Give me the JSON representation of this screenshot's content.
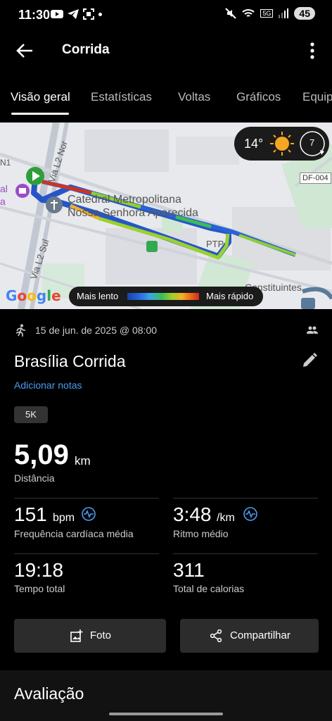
{
  "status_bar": {
    "time": "11:30",
    "battery": "45",
    "network": "5G"
  },
  "app_bar": {
    "title": "Corrida"
  },
  "tabs": [
    {
      "label": "Visão geral"
    },
    {
      "label": "Estatísticas"
    },
    {
      "label": "Voltas"
    },
    {
      "label": "Gráficos"
    },
    {
      "label": "Equip"
    }
  ],
  "map": {
    "weather": {
      "temp": "14°",
      "wind": "7"
    },
    "labels": {
      "road_l2_norte": "Via L2 Nor",
      "road_l2_sul": "Via L2 Sul",
      "road_n1": "N1",
      "cathedral_1": "Catedral Metropolitana",
      "cathedral_2": "Nossa Senhora Aparecida",
      "ptp": "PTP",
      "df004": "DF-004",
      "left_1": "al",
      "left_2": "a",
      "constituintes": "Constituintes"
    },
    "legend": {
      "slow": "Mais lento",
      "fast": "Mais rápido"
    },
    "attribution": "Google"
  },
  "activity": {
    "date": "15 de jun. de 2025 @ 08:00",
    "title": "Brasília Corrida",
    "add_notes": "Adicionar notas",
    "chip": "5K",
    "distance": {
      "value": "5,09",
      "unit": "km",
      "label": "Distância"
    },
    "heart_rate": {
      "value": "151",
      "unit": "bpm",
      "label": "Frequência cardíaca média"
    },
    "pace": {
      "value": "3:48",
      "unit": "/km",
      "label": "Ritmo médio"
    },
    "total_time": {
      "value": "19:18",
      "label": "Tempo total"
    },
    "calories": {
      "value": "311",
      "label": "Total de calorias"
    }
  },
  "buttons": {
    "photo": "Foto",
    "share": "Compartilhar"
  },
  "section": {
    "title": "Avaliação"
  },
  "colors": {
    "accent": "#4a9df0",
    "background": "#000000",
    "button": "#2c2c2c"
  }
}
